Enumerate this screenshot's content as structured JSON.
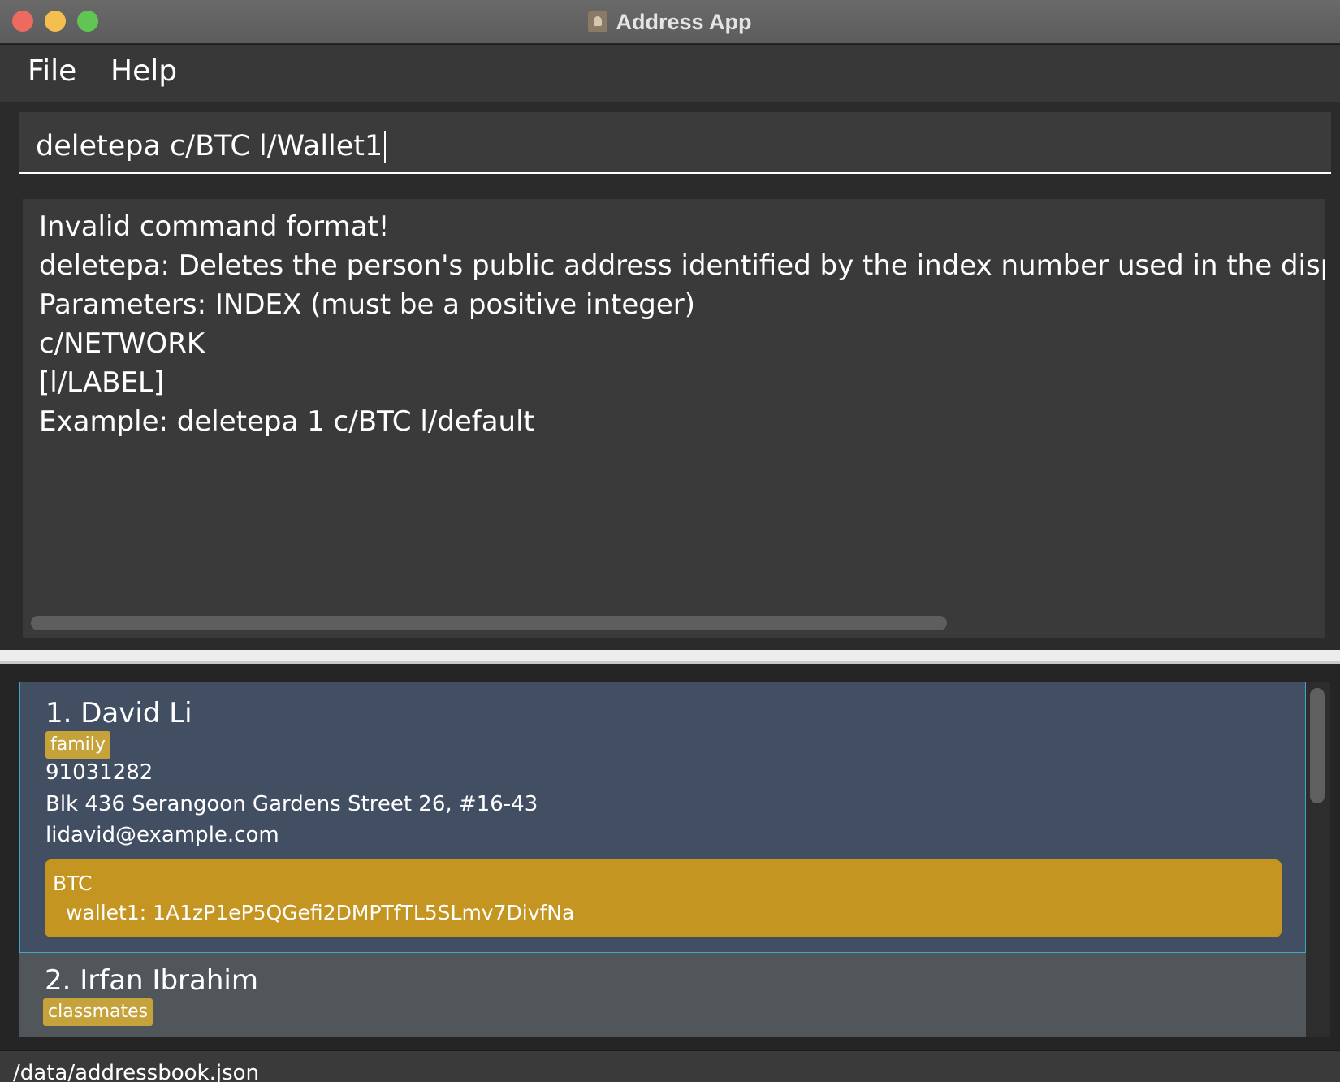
{
  "window": {
    "title": "Address App"
  },
  "menu": {
    "file": "File",
    "help": "Help"
  },
  "command": {
    "value": "deletepa c/BTC l/Wallet1"
  },
  "result": {
    "lines": [
      "Invalid command format!",
      "deletepa: Deletes the person's public address identified by the index number used in the displaye",
      "Parameters: INDEX (must be a positive integer)",
      "c/NETWORK",
      "[l/LABEL]",
      "Example: deletepa 1 c/BTC l/default"
    ]
  },
  "persons": [
    {
      "name": "1. David Li",
      "tag": "family",
      "phone": "91031282",
      "address": "Blk 436 Serangoon Gardens Street 26, #16-43",
      "email": "lidavid@example.com",
      "wallet_network": "BTC",
      "wallet_entry": "wallet1: 1A1zP1eP5QGefi2DMPTfTL5SLmv7DivfNa"
    },
    {
      "name": "2. Irfan Ibrahim",
      "tag": "classmates"
    }
  ],
  "status": {
    "path": "/data/addressbook.json"
  }
}
